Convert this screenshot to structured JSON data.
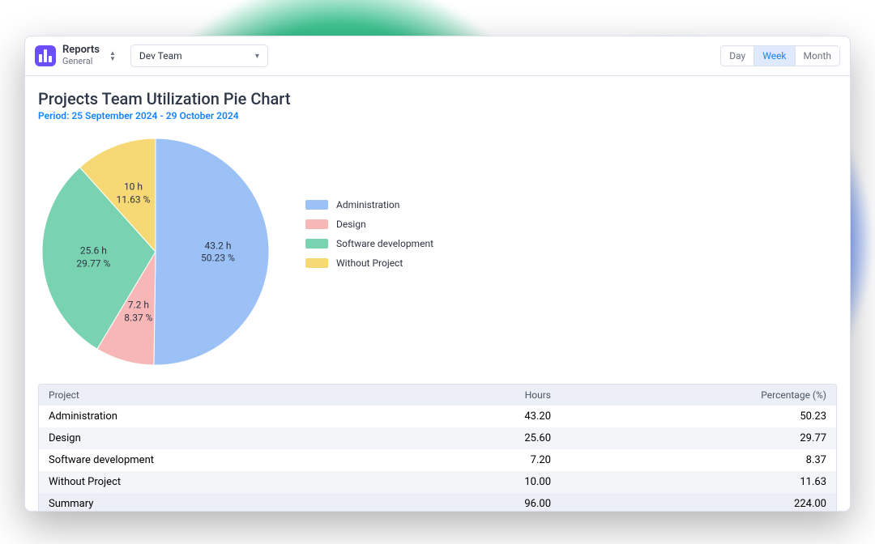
{
  "header": {
    "brand_title": "Reports",
    "brand_subtitle": "General",
    "team_selected": "Dev Team",
    "range": {
      "day": "Day",
      "week": "Week",
      "month": "Month",
      "active": "week"
    }
  },
  "page": {
    "title": "Projects Team Utilization Pie Chart",
    "period_prefix": "Period: ",
    "period": "25 September 2024 - 29 October 2024"
  },
  "table": {
    "columns": [
      "Project",
      "Hours",
      "Percentage (%)"
    ],
    "rows": [
      {
        "project": "Administration",
        "hours": "43.20",
        "pct": "50.23"
      },
      {
        "project": "Design",
        "hours": "25.60",
        "pct": "29.77"
      },
      {
        "project": "Software development",
        "hours": "7.20",
        "pct": "8.37"
      },
      {
        "project": "Without Project",
        "hours": "10.00",
        "pct": "11.63"
      }
    ],
    "summary": {
      "label": "Summary",
      "hours": "96.00",
      "pct": "224.00"
    }
  },
  "chart_data": {
    "type": "pie",
    "title": "Projects Team Utilization Pie Chart",
    "unit": "hours",
    "series": [
      {
        "name": "Administration",
        "value": 43.2,
        "pct": 50.23,
        "color": "#9cc1f6",
        "label_hours": "43.2 h",
        "label_pct": "50.23 %"
      },
      {
        "name": "Design",
        "value": 7.2,
        "pct": 8.37,
        "color": "#f7b7b7",
        "label_hours": "7.2 h",
        "label_pct": "8.37 %"
      },
      {
        "name": "Software development",
        "value": 25.6,
        "pct": 29.77,
        "color": "#79d3b1",
        "label_hours": "25.6 h",
        "label_pct": "29.77 %"
      },
      {
        "name": "Without Project",
        "value": 10.0,
        "pct": 11.63,
        "color": "#f6d875",
        "label_hours": "10 h",
        "label_pct": "11.63 %"
      }
    ]
  }
}
